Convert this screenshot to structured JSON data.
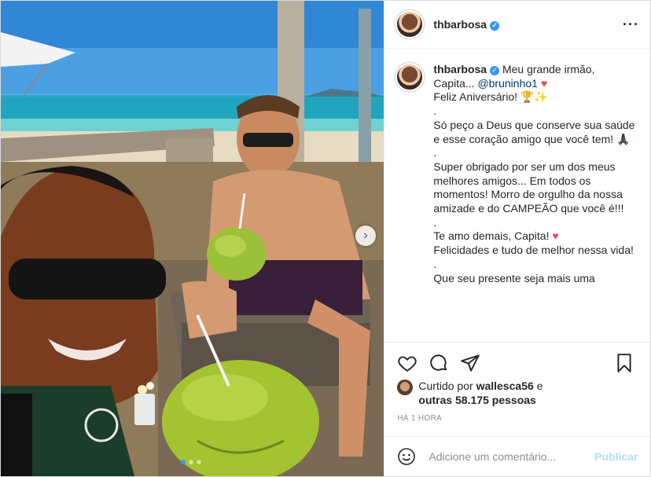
{
  "post": {
    "username": "thbarbosa",
    "verified_mark": "✓",
    "more_label": "···",
    "caption": {
      "username": "thbarbosa",
      "line1": "Meu grande irmão, Capita... ",
      "mention": "@bruninho1",
      "line2": "Feliz Aniversário! 🏆✨",
      "dot1": ".",
      "line3": "Só peço a Deus que conserve sua saúde e esse coração amigo que você tem! 🙏🏿",
      "dot2": ".",
      "line4": "Super obrigado por ser um dos meus melhores amigos... Em todos os momentos! Morro de orgulho da nossa amizade e do CAMPEÃO que você é!!!",
      "dot3": ".",
      "line5": "Te amo demais, Capita! ",
      "line6": "Felicidades e tudo de melhor nessa vida!",
      "dot4": ".",
      "line7": "Que seu presente seja mais uma"
    },
    "likes": {
      "prefix": "Curtido por ",
      "liker": "wallesca56",
      "middle": " e",
      "others": "outras 58.175 pessoas"
    },
    "timestamp": "HÁ 1 HORA",
    "comment_placeholder": "Adicione um comentário...",
    "publish_label": "Publicar",
    "next_arrow": "›",
    "carousel_count": 3,
    "carousel_active": 0,
    "icons": [
      "heart-outline-icon",
      "comment-icon",
      "share-icon",
      "bookmark-icon",
      "emoji-icon",
      "verified-badge-icon",
      "more-options-icon"
    ],
    "colors": {
      "accent": "#3897f0",
      "heart": "#ed4956",
      "publish_disabled": "#b2dffc",
      "muted": "#8e8e8e"
    }
  }
}
